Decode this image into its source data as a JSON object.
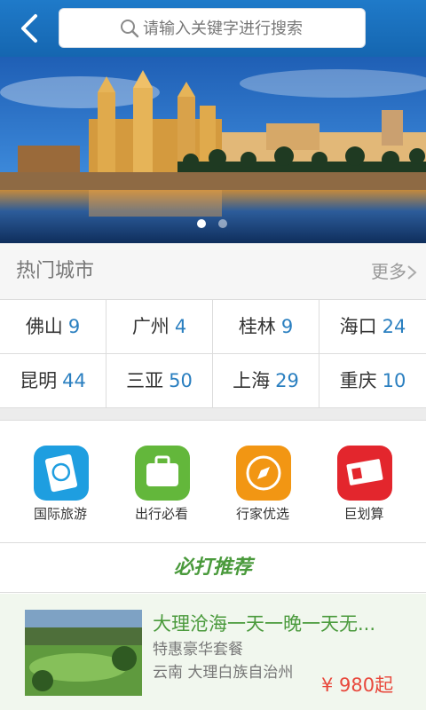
{
  "header": {
    "back_icon": "chevron-left-icon",
    "search_placeholder": "请输入关键字进行搜索",
    "search_icon": "search-icon"
  },
  "banner": {
    "slides": 2,
    "active_slide": 1
  },
  "hot_cities": {
    "title": "热门城市",
    "more": "更多",
    "cities": [
      {
        "name": "佛山",
        "count": "9"
      },
      {
        "name": "广州",
        "count": "4"
      },
      {
        "name": "桂林",
        "count": "9"
      },
      {
        "name": "海口",
        "count": "24"
      },
      {
        "name": "昆明",
        "count": "44"
      },
      {
        "name": "三亚",
        "count": "50"
      },
      {
        "name": "上海",
        "count": "29"
      },
      {
        "name": "重庆",
        "count": "10"
      }
    ]
  },
  "categories": [
    {
      "label": "国际旅游",
      "icon": "passport-icon",
      "color": "#1e9ee0"
    },
    {
      "label": "出行必看",
      "icon": "suitcase-icon",
      "color": "#63b73b"
    },
    {
      "label": "行家优选",
      "icon": "compass-icon",
      "color": "#f29613"
    },
    {
      "label": "巨划算",
      "icon": "ticket-icon",
      "color": "#e3262d"
    }
  ],
  "recommend": {
    "title": "必打推荐",
    "items": [
      {
        "title": "大理沧海一天一晚一天无...",
        "subtitle": "特惠豪华套餐",
        "location": "云南 大理白族自治州",
        "price": "¥ 980起"
      }
    ]
  },
  "colors": {
    "header": "#1a6fbd",
    "accent_green": "#4a9a3c",
    "price_red": "#e8483c",
    "count_blue": "#2a7fc0"
  }
}
